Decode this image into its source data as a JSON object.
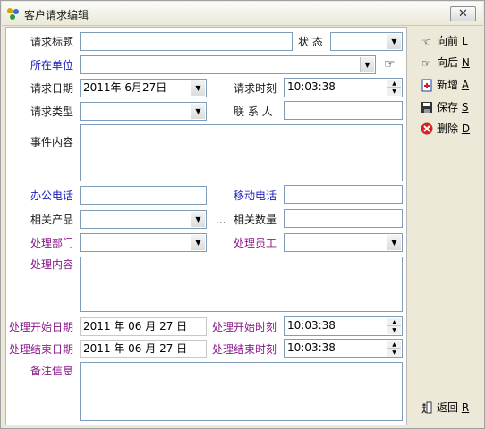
{
  "window": {
    "title": "客户请求编辑",
    "close_icon": "close-icon"
  },
  "fields": {
    "title_label": "请求标题",
    "status_label": "状 态",
    "unit_label": "所在单位",
    "date_label": "请求日期",
    "date_value": "2011年  6月27日",
    "time_label": "请求时刻",
    "time_value": "10:03:38",
    "type_label": "请求类型",
    "contact_label": "联 系 人",
    "event_label": "事件内容",
    "office_phone_label": "办公电话",
    "mobile_label": "移动电话",
    "product_label": "相关产品",
    "product_ellipsis": "...",
    "quantity_label": "相关数量",
    "dept_label": "处理部门",
    "staff_label": "处理员工",
    "handle_label": "处理内容",
    "start_date_label": "处理开始日期",
    "start_date_value": "2011 年 06 月 27 日",
    "start_time_label": "处理开始时刻",
    "start_time_value": "10:03:38",
    "end_date_label": "处理结束日期",
    "end_date_value": "2011 年 06 月 27 日",
    "end_time_label": "处理结束时刻",
    "end_time_value": "10:03:38",
    "note_label": "备注信息"
  },
  "sidebar": {
    "prev": {
      "label": "向前 ",
      "key": "L"
    },
    "next": {
      "label": "向后 ",
      "key": "N"
    },
    "add": {
      "label": "新增 ",
      "key": "A"
    },
    "save": {
      "label": "保存 ",
      "key": "S"
    },
    "delete": {
      "label": "删除 ",
      "key": "D"
    },
    "back": {
      "label": "返回 ",
      "key": "R"
    }
  },
  "colors": {
    "label_default": "#1a1a1a",
    "label_blue": "#1c1cbe",
    "label_purple": "#8a1a8a",
    "window_bg": "#ece9d8",
    "delete_red": "#d42222"
  }
}
